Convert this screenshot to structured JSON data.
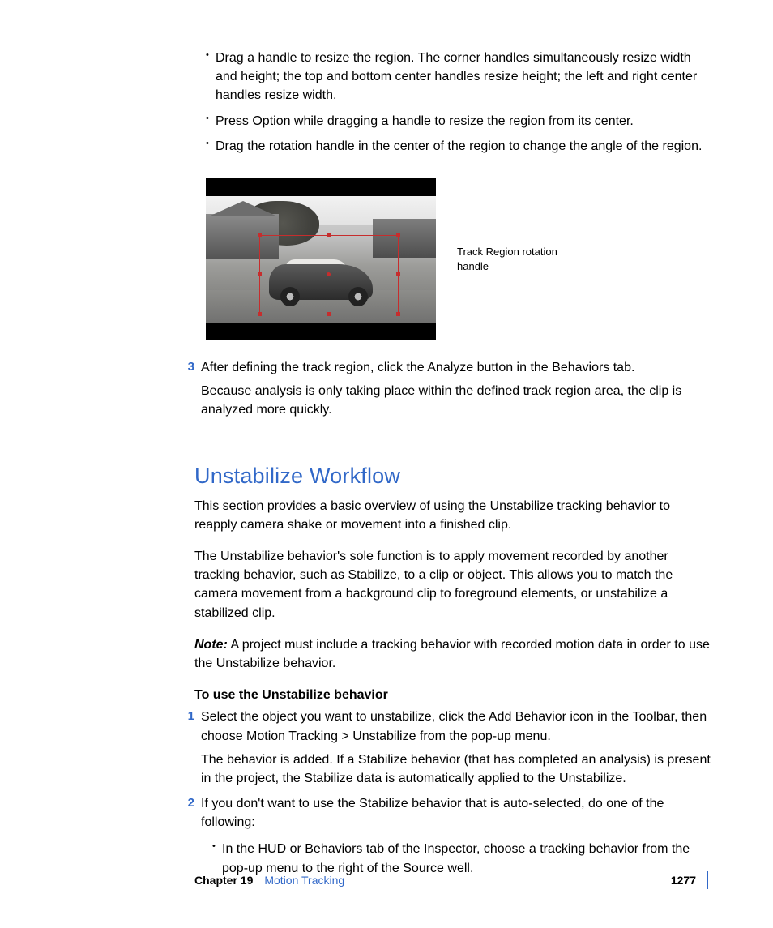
{
  "bullets_a": [
    "Drag a handle to resize the region. The corner handles simultaneously resize width and height; the top and bottom center handles resize height; the left and right center handles resize width.",
    "Press Option while dragging a handle to resize the region from its center.",
    "Drag the rotation handle in the center of the region to change the angle of the region."
  ],
  "figure_callout": "Track Region rotation handle",
  "step3": {
    "num": "3",
    "line1": "After defining the track region, click the Analyze button in the Behaviors tab.",
    "line2": "Because analysis is only taking place within the defined track region area, the clip is analyzed more quickly."
  },
  "section_heading": "Unstabilize Workflow",
  "p1": "This section provides a basic overview of using the Unstabilize tracking behavior to reapply camera shake or movement into a finished clip.",
  "p2": "The Unstabilize behavior's sole function is to apply movement recorded by another tracking behavior, such as Stabilize, to a clip or object. This allows you to match the camera movement from a background clip to foreground elements, or unstabilize a stabilized clip.",
  "note_label": "Note:",
  "note_text": "  A project must include a tracking behavior with recorded motion data in order to use the Unstabilize behavior.",
  "sub_heading": "To use the Unstabilize behavior",
  "step1": {
    "num": "1",
    "line1": "Select the object you want to unstabilize, click the Add Behavior icon in the Toolbar, then choose Motion Tracking > Unstabilize from the pop-up menu.",
    "line2": "The behavior is added. If a Stabilize behavior (that has completed an analysis) is present in the project, the Stabilize data is automatically applied to the Unstabilize."
  },
  "step2": {
    "num": "2",
    "line1": "If you don't want to use the Stabilize behavior that is auto-selected, do one of the following:"
  },
  "bullets_b": [
    "In the HUD or Behaviors tab of the Inspector, choose a tracking behavior from the pop-up menu to the right of the Source well."
  ],
  "footer": {
    "chapter": "Chapter 19",
    "title": "Motion Tracking",
    "page": "1277"
  }
}
